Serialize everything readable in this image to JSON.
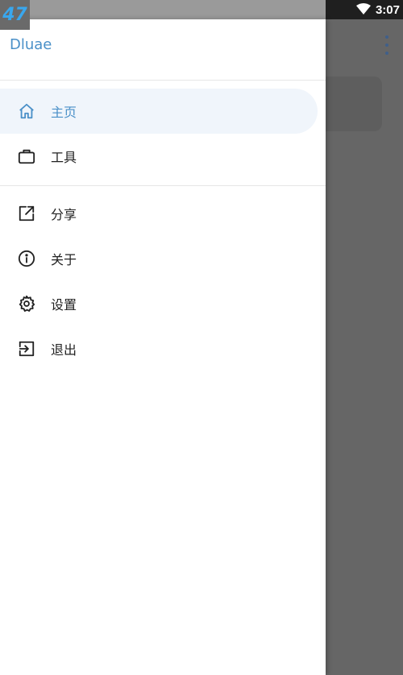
{
  "status_bar": {
    "badge": "47",
    "time": "3:07",
    "wifi_icon": "wifi-icon"
  },
  "drawer": {
    "title": "Dluae",
    "primary_items": [
      {
        "label": "主页",
        "icon": "home-icon",
        "active": true
      },
      {
        "label": "工具",
        "icon": "briefcase-icon",
        "active": false
      }
    ],
    "secondary_items": [
      {
        "label": "分享",
        "icon": "share-icon"
      },
      {
        "label": "关于",
        "icon": "info-icon"
      },
      {
        "label": "设置",
        "icon": "gear-icon"
      },
      {
        "label": "退出",
        "icon": "logout-icon"
      }
    ]
  },
  "colors": {
    "accent": "#4a90c8",
    "active_bg": "#f0f5fb",
    "scrim": "#6b6b6b"
  },
  "background_app": {
    "more_icon": "more-vert-icon"
  }
}
